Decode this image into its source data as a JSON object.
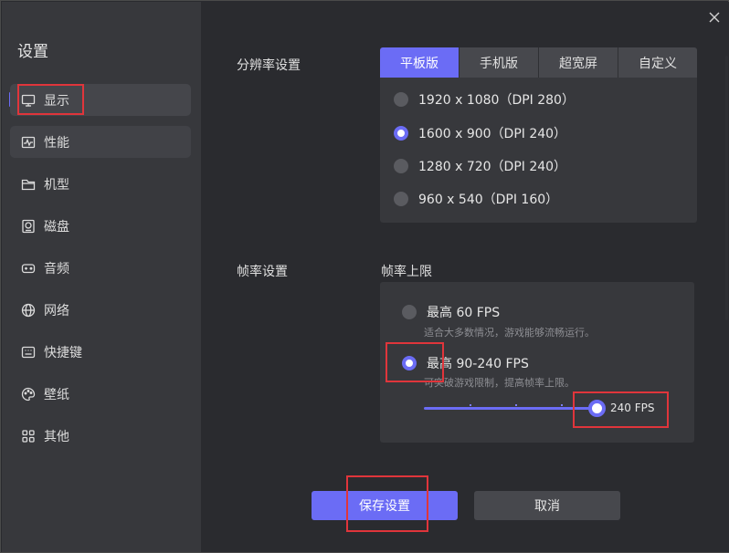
{
  "sidebar": {
    "title": "设置",
    "items": [
      {
        "label": "显示",
        "icon": "monitor-icon"
      },
      {
        "label": "性能",
        "icon": "activity-icon"
      },
      {
        "label": "机型",
        "icon": "folder-icon"
      },
      {
        "label": "磁盘",
        "icon": "disk-icon"
      },
      {
        "label": "音频",
        "icon": "gamepad-icon"
      },
      {
        "label": "网络",
        "icon": "globe-icon"
      },
      {
        "label": "快捷键",
        "icon": "keyboard-icon"
      },
      {
        "label": "壁纸",
        "icon": "palette-icon"
      },
      {
        "label": "其他",
        "icon": "grid-icon"
      }
    ]
  },
  "resolution": {
    "label": "分辨率设置",
    "tabs": [
      "平板版",
      "手机版",
      "超宽屏",
      "自定义"
    ],
    "active_tab": 0,
    "options": [
      {
        "label": "1920 x 1080（DPI 280）",
        "checked": false
      },
      {
        "label": "1600 x 900（DPI 240）",
        "checked": true
      },
      {
        "label": "1280 x 720（DPI 240）",
        "checked": false
      },
      {
        "label": "960 x 540（DPI 160）",
        "checked": false
      }
    ]
  },
  "framerate": {
    "label": "帧率设置",
    "sub_label": "帧率上限",
    "options": [
      {
        "label": "最高 60 FPS",
        "desc": "适合大多数情况，游戏能够流畅运行。",
        "checked": false
      },
      {
        "label": "最高 90-240 FPS",
        "desc": "可突破游戏限制，提高帧率上限。",
        "checked": true
      }
    ],
    "slider_value": "240 FPS",
    "slider_fraction": 1.0
  },
  "buttons": {
    "save": "保存设置",
    "cancel": "取消"
  },
  "colors": {
    "accent": "#6b6cf5",
    "highlight": "#e0353b"
  }
}
